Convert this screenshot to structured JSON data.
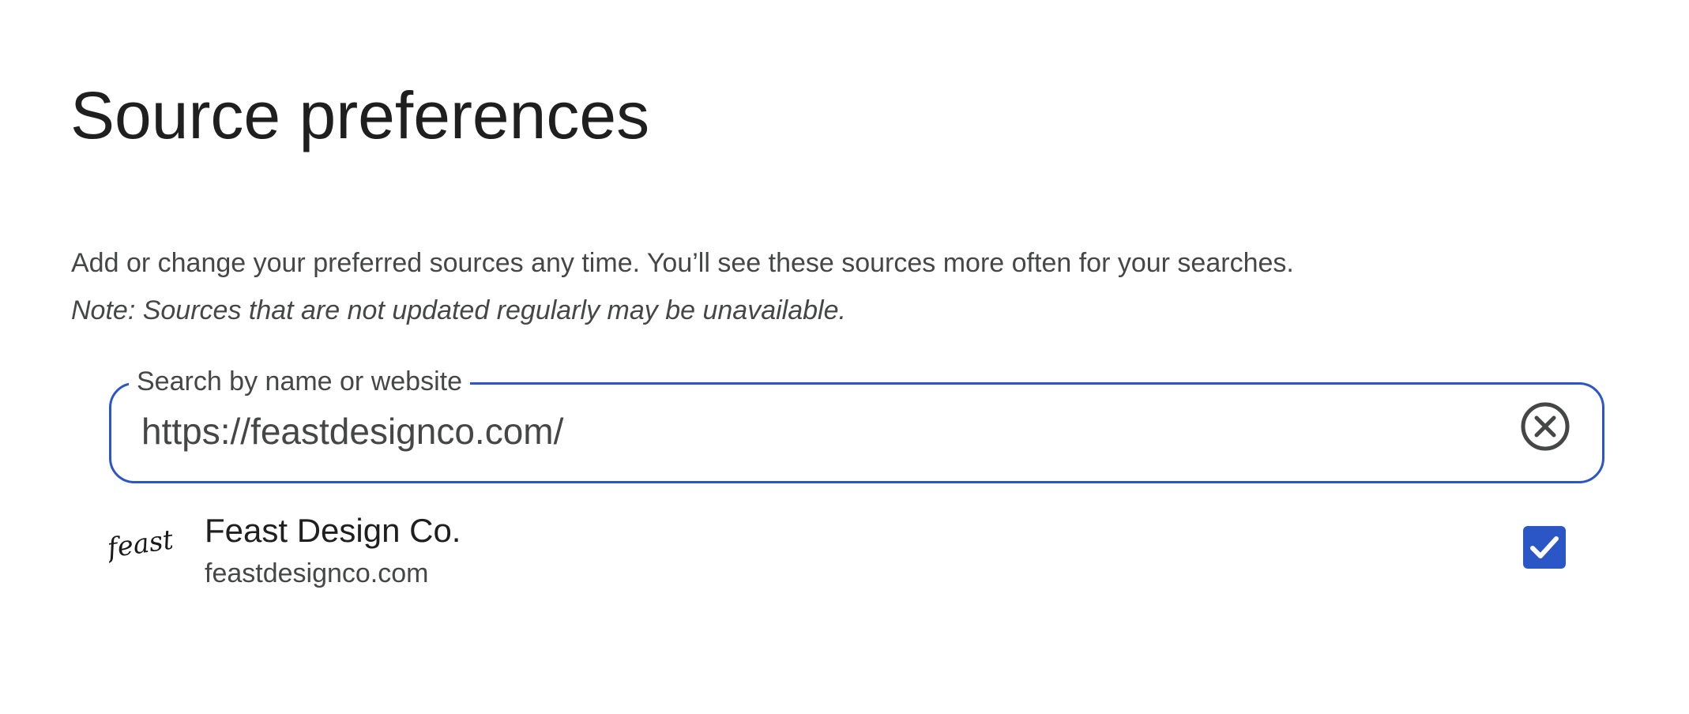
{
  "page": {
    "title": "Source preferences",
    "description": "Add or change your preferred sources any time. You’ll see these sources more often for your searches.",
    "note": "Note: Sources that are not updated regularly may be unavailable."
  },
  "search": {
    "label": "Search by name or website",
    "value": "https://feastdesignco.com/",
    "clear_icon": "close-circle-icon"
  },
  "results": [
    {
      "name": "Feast Design Co.",
      "domain": "feastdesignco.com",
      "logo_text": "feast",
      "checked": true
    }
  ],
  "colors": {
    "accent": "#2b56c5",
    "text_primary": "#1f1f1f",
    "text_secondary": "#444746"
  }
}
